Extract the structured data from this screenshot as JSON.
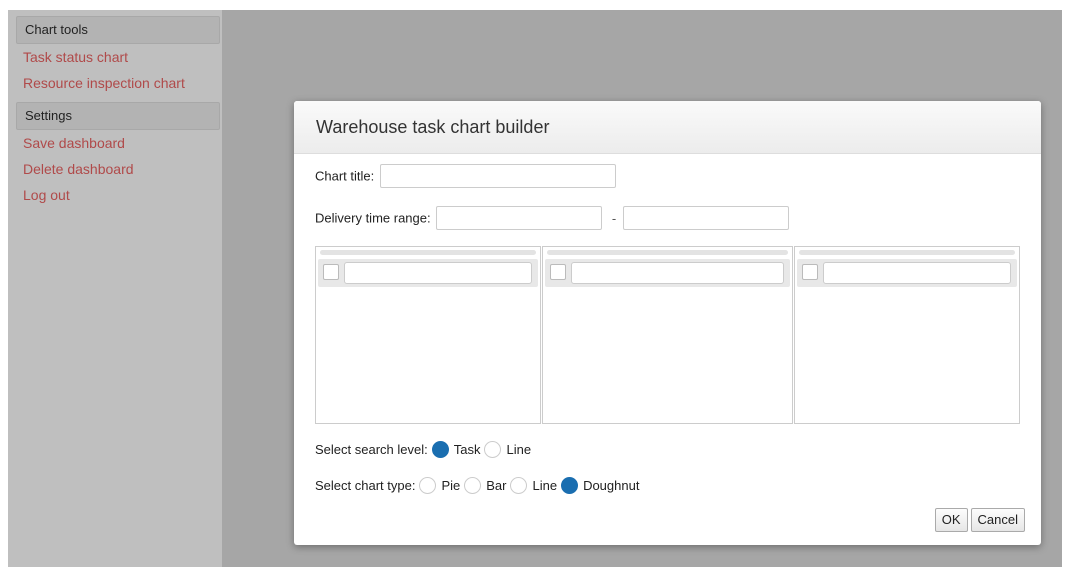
{
  "sidebar": {
    "sections": [
      {
        "header": "Chart tools",
        "items": [
          "Task status chart",
          "Resource inspection chart"
        ]
      },
      {
        "header": "Settings",
        "items": [
          "Save dashboard",
          "Delete dashboard",
          "Log out"
        ]
      }
    ]
  },
  "dialog": {
    "title": "Warehouse task chart builder",
    "chart_title_label": "Chart title:",
    "chart_title_value": "",
    "delivery_label": "Delivery time range:",
    "delivery_from": "",
    "delivery_separator": "-",
    "delivery_to": "",
    "search_level_label": "Select search level:",
    "search_level_options": [
      "Task",
      "Line"
    ],
    "search_level_selected": "Task",
    "chart_type_label": "Select chart type:",
    "chart_type_options": [
      "Pie",
      "Bar",
      "Line",
      "Doughnut"
    ],
    "chart_type_selected": "Doughnut",
    "ok_label": "OK",
    "cancel_label": "Cancel"
  },
  "colors": {
    "link": "#b04a4a",
    "radio_selected": "#1a6eb0"
  }
}
